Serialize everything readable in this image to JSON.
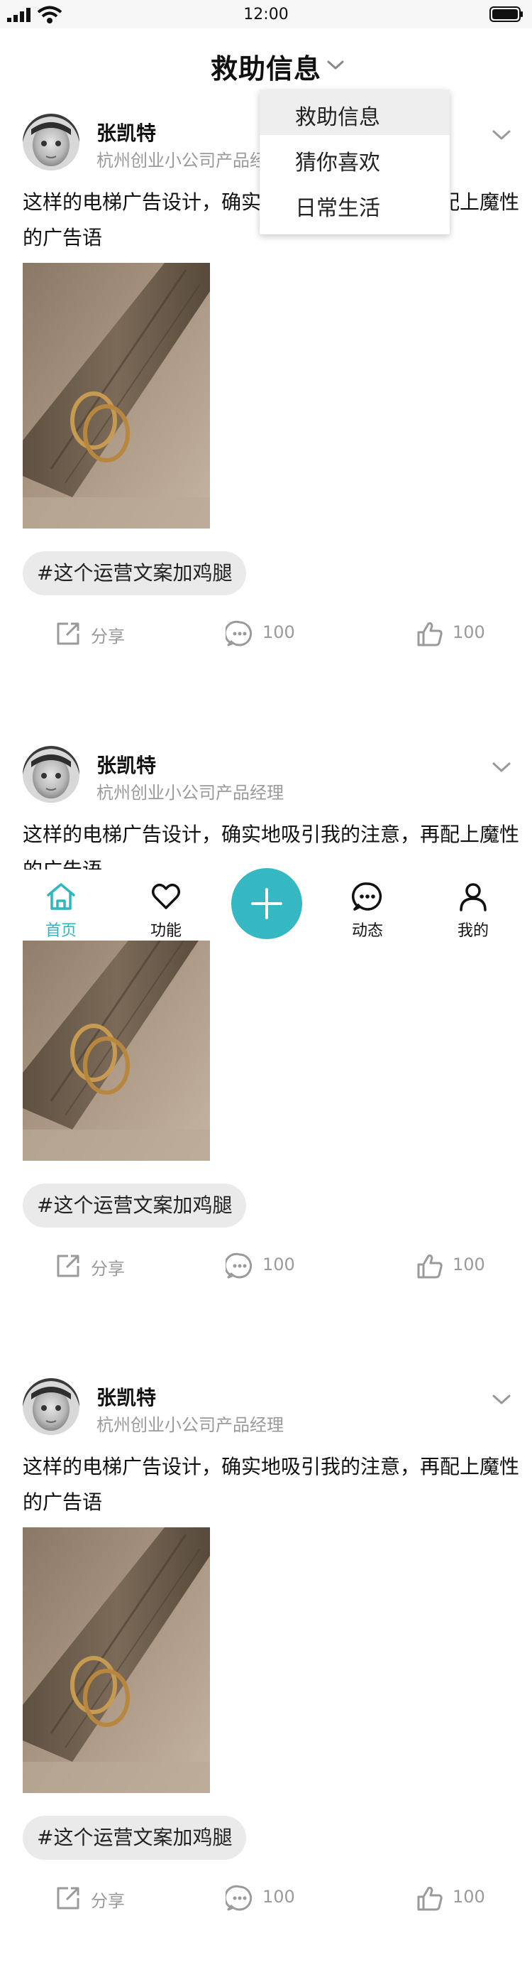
{
  "status_bar": {
    "time": "12:00",
    "icons": [
      "signal-icon",
      "wifi-icon",
      "battery-icon"
    ]
  },
  "header": {
    "title": "救助信息",
    "icon": "chevron-down-icon"
  },
  "dropdown": {
    "items": [
      {
        "label": "救助信息",
        "active": true
      },
      {
        "label": "猜你喜欢",
        "active": false
      },
      {
        "label": "日常生活",
        "active": false
      }
    ]
  },
  "posts": [
    {
      "user_name": "张凯特",
      "user_subtitle": "杭州创业小公司产品经理",
      "text": "这样的电梯广告设计，确实地吸引我的注意，再配上魔性的广告语",
      "hashtag": "#这个运营文案加鸡腿",
      "share_label": "分享",
      "comment_count": "100",
      "like_count": "100"
    },
    {
      "user_name": "张凯特",
      "user_subtitle": "杭州创业小公司产品经理",
      "text": "这样的电梯广告设计，确实地吸引我的注意，再配上魔性的广告语",
      "hashtag": "#这个运营文案加鸡腿",
      "share_label": "分享",
      "comment_count": "100",
      "like_count": "100"
    },
    {
      "user_name": "张凯特",
      "user_subtitle": "杭州创业小公司产品经理",
      "text": "这样的电梯广告设计，确实地吸引我的注意，再配上魔性的广告语",
      "hashtag": "#这个运营文案加鸡腿",
      "share_label": "分享",
      "comment_count": "100",
      "like_count": "100"
    }
  ],
  "tab_bar": {
    "tabs": [
      {
        "label": "首页",
        "icon": "home-icon",
        "active": true
      },
      {
        "label": "功能",
        "icon": "heart-icon",
        "active": false
      },
      {
        "label": "动态",
        "icon": "chat-icon",
        "active": false
      },
      {
        "label": "我的",
        "icon": "user-icon",
        "active": false
      }
    ],
    "center_button_icon": "plus-icon"
  },
  "colors": {
    "accent": "#36b8c3",
    "active_tab_text": "#2fb6c0",
    "secondary_text": "#9a9a9a",
    "tag_background": "#eaeaea"
  }
}
